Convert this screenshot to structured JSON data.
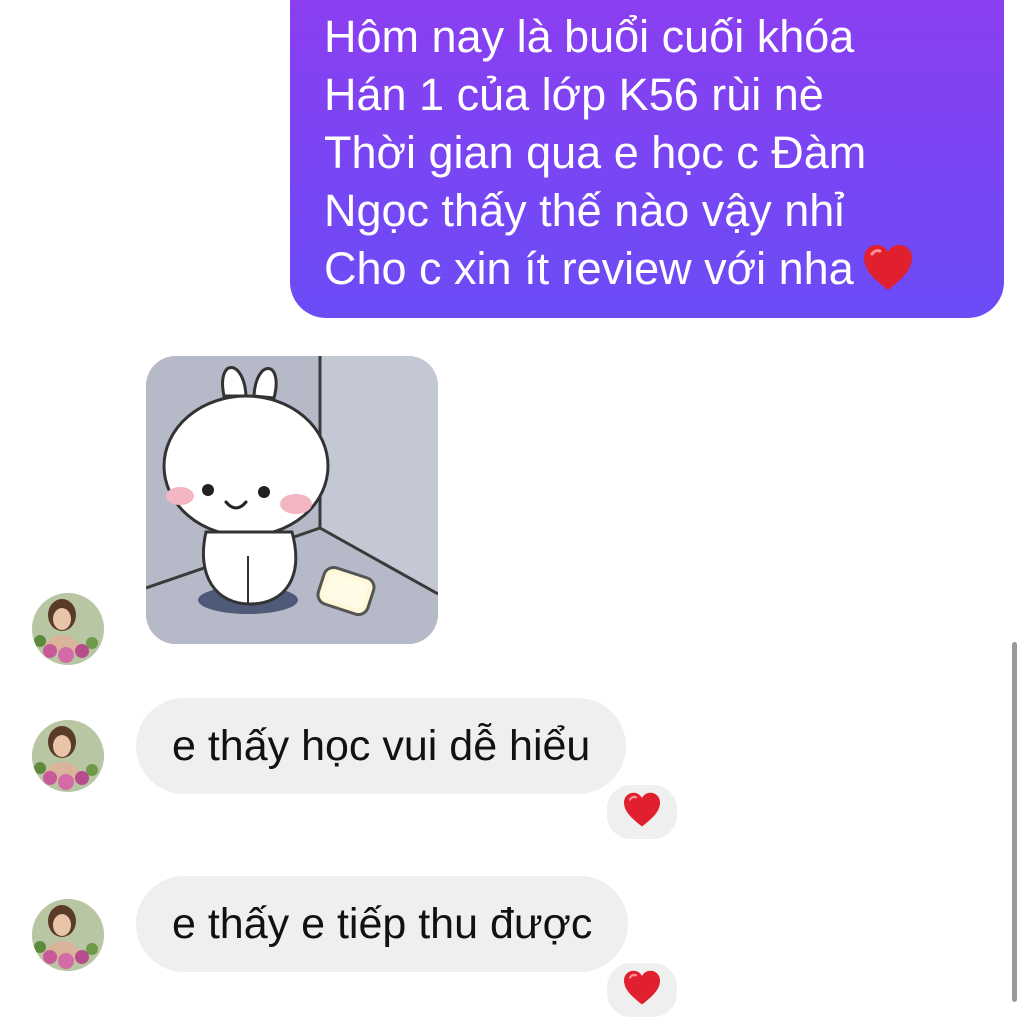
{
  "outgoing_message": {
    "lines": [
      "Hôm nay là buổi cuối khóa",
      "Hán 1 của lớp K56 rùi nè",
      "Thời gian qua e học c Đàm",
      "Ngọc thấy thế nào vậy nhỉ",
      "Cho c xin ít review với nha"
    ],
    "emoji": "heart-icon"
  },
  "incoming_messages": [
    {
      "type": "sticker",
      "sticker_icon": "bunny-sticker-icon"
    },
    {
      "type": "text",
      "text": "e thấy học vui dễ hiểu",
      "reaction": "heart-icon"
    },
    {
      "type": "text",
      "text": "e thấy e tiếp thu được",
      "reaction": "heart-icon"
    }
  ],
  "colors": {
    "outgoing_bubble": "#7a45f3",
    "incoming_bubble": "#efefef",
    "heart": "#e0202e"
  }
}
